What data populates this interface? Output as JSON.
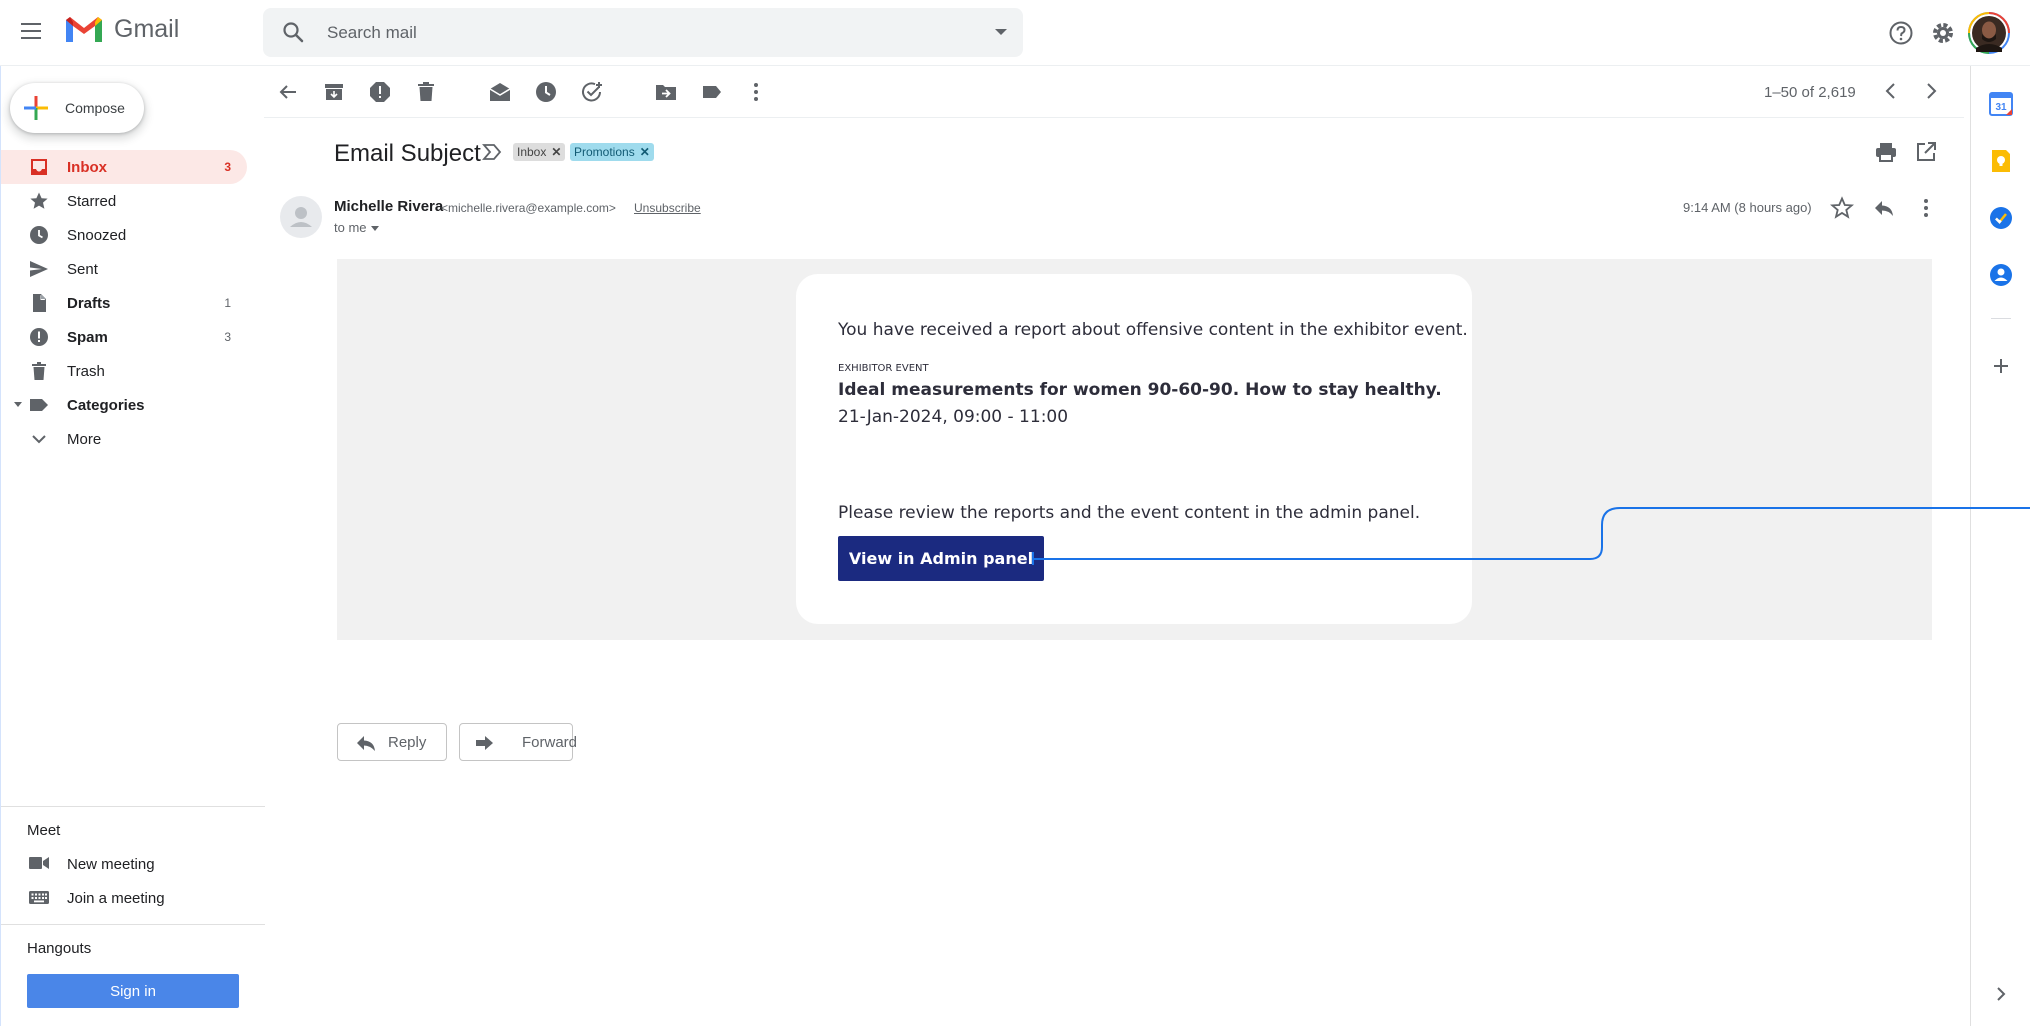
{
  "header": {
    "app_name": "Gmail",
    "search_placeholder": "Search mail"
  },
  "compose_label": "Compose",
  "sidebar": {
    "items": [
      {
        "label": "Inbox",
        "count": "3"
      },
      {
        "label": "Starred",
        "count": ""
      },
      {
        "label": "Snoozed",
        "count": ""
      },
      {
        "label": "Sent",
        "count": ""
      },
      {
        "label": "Drafts",
        "count": "1"
      },
      {
        "label": "Spam",
        "count": "3"
      },
      {
        "label": "Trash",
        "count": ""
      },
      {
        "label": "Categories",
        "count": ""
      },
      {
        "label": "More",
        "count": ""
      }
    ],
    "meet": {
      "heading": "Meet",
      "new_meeting": "New meeting",
      "join_meeting": "Join a meeting"
    },
    "hangouts": {
      "heading": "Hangouts",
      "sign_in": "Sign in"
    }
  },
  "toolbar": {
    "pagination": "1–50 of 2,619"
  },
  "message": {
    "subject": "Email Subject",
    "labels": [
      {
        "name": "Inbox"
      },
      {
        "name": "Promotions"
      }
    ],
    "sender_name": "Michelle Rivera",
    "sender_email": "<michelle.rivera@example.com>",
    "unsubscribe": "Unsubscribe",
    "recipient": "to me",
    "time": "9:14 AM (8 hours ago)"
  },
  "email_content": {
    "intro": "You have received a report about offensive content in the exhibitor event.",
    "tag": "EXHIBITOR EVENT",
    "event_title": "Ideal measurements for women 90-60-90. How to stay healthy.",
    "event_date": "21-Jan-2024, 09:00 - 11:00",
    "review_text": "Please review the reports and the event content in the admin panel.",
    "cta_label": "View in Admin panel"
  },
  "actions": {
    "reply": "Reply",
    "forward": "Forward"
  },
  "colors": {
    "gmail_red": "#d93025",
    "inbox_active_bg": "#fce8e6",
    "promotions_chip": "#9fdbed",
    "cta_navy": "#1b2a80",
    "sign_in_blue": "#4a86e8",
    "connector_blue": "#1a73e8"
  }
}
